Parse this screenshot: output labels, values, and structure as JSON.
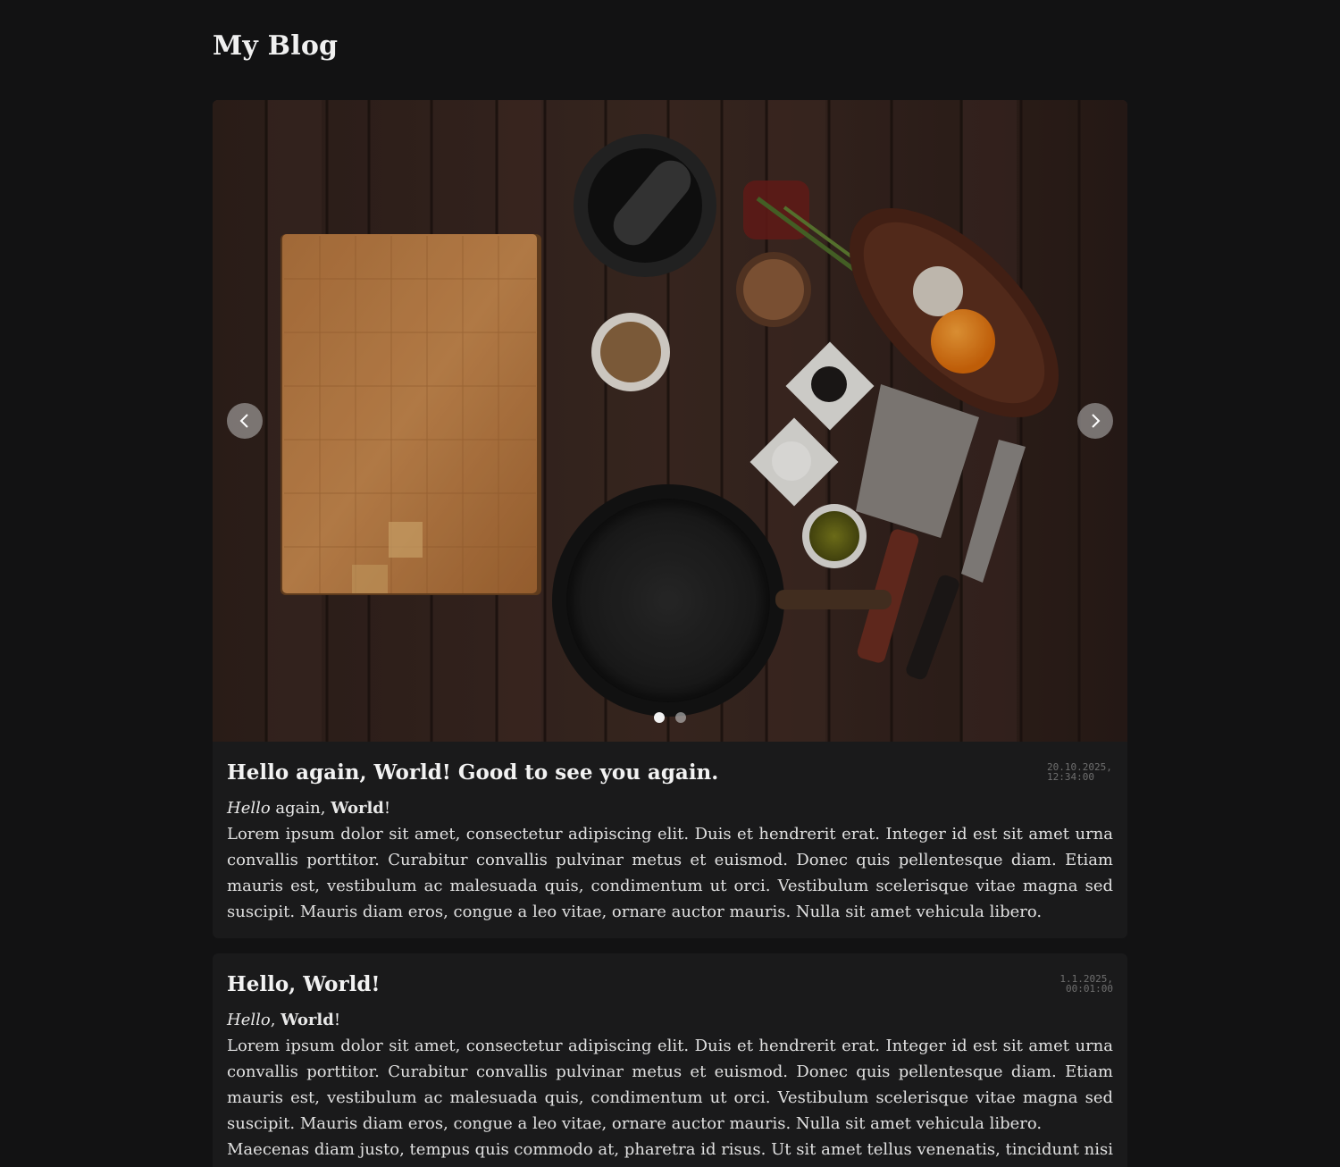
{
  "site": {
    "title": "My Blog"
  },
  "carousel": {
    "image_alt": "Overhead view of kitchen tools and spices on a dark wooden table",
    "prev_icon": "chevron-left-icon",
    "next_icon": "chevron-right-icon",
    "slide_count": 2,
    "active_slide": 1
  },
  "posts": [
    {
      "title": "Hello again, World! Good to see you again.",
      "date_line1": "20.10.2025,",
      "date_line2": "12:34:00",
      "greeting_italic": "Hello",
      "greeting_mid": " again, ",
      "greeting_bold": "World",
      "greeting_end": "!",
      "paragraphs": [
        "Lorem ipsum dolor sit amet, consectetur adipiscing elit. Duis et hendrerit erat. Integer id est sit amet urna convallis porttitor. Curabitur convallis pulvinar metus et euismod. Donec quis pellentesque diam. Etiam mauris est, vestibulum ac malesuada quis, condimentum ut orci. Vestibulum scelerisque vitae magna sed suscipit. Mauris diam eros, congue a leo vitae, ornare auc­tor mauris. Nulla sit amet vehicula libero."
      ]
    },
    {
      "title": "Hello, World!",
      "date_line1": "1.1.2025,",
      "date_line2": "00:01:00",
      "greeting_italic": "Hello",
      "greeting_mid": ", ",
      "greeting_bold": "World",
      "greeting_end": "!",
      "paragraphs": [
        "Lorem ipsum dolor sit amet, consectetur adipiscing elit. Duis et hendrerit erat. Integer id est sit amet urna convallis porttitor. Curabitur convallis pulvinar metus et euismod. Donec quis pellentesque diam. Etiam mauris est, vestibulum ac malesuada quis, condimentum ut orci. Vestibulum scelerisque vitae magna sed suscipit. Mauris diam eros, congue a leo vitae, ornare auc­tor mauris. Nulla sit amet vehicula libero.",
        "Maecenas diam justo, tempus quis commodo at, pharetra id risus. Ut sit amet tellus venenatis, tincidunt nisi quis, rhoncus"
      ]
    }
  ]
}
